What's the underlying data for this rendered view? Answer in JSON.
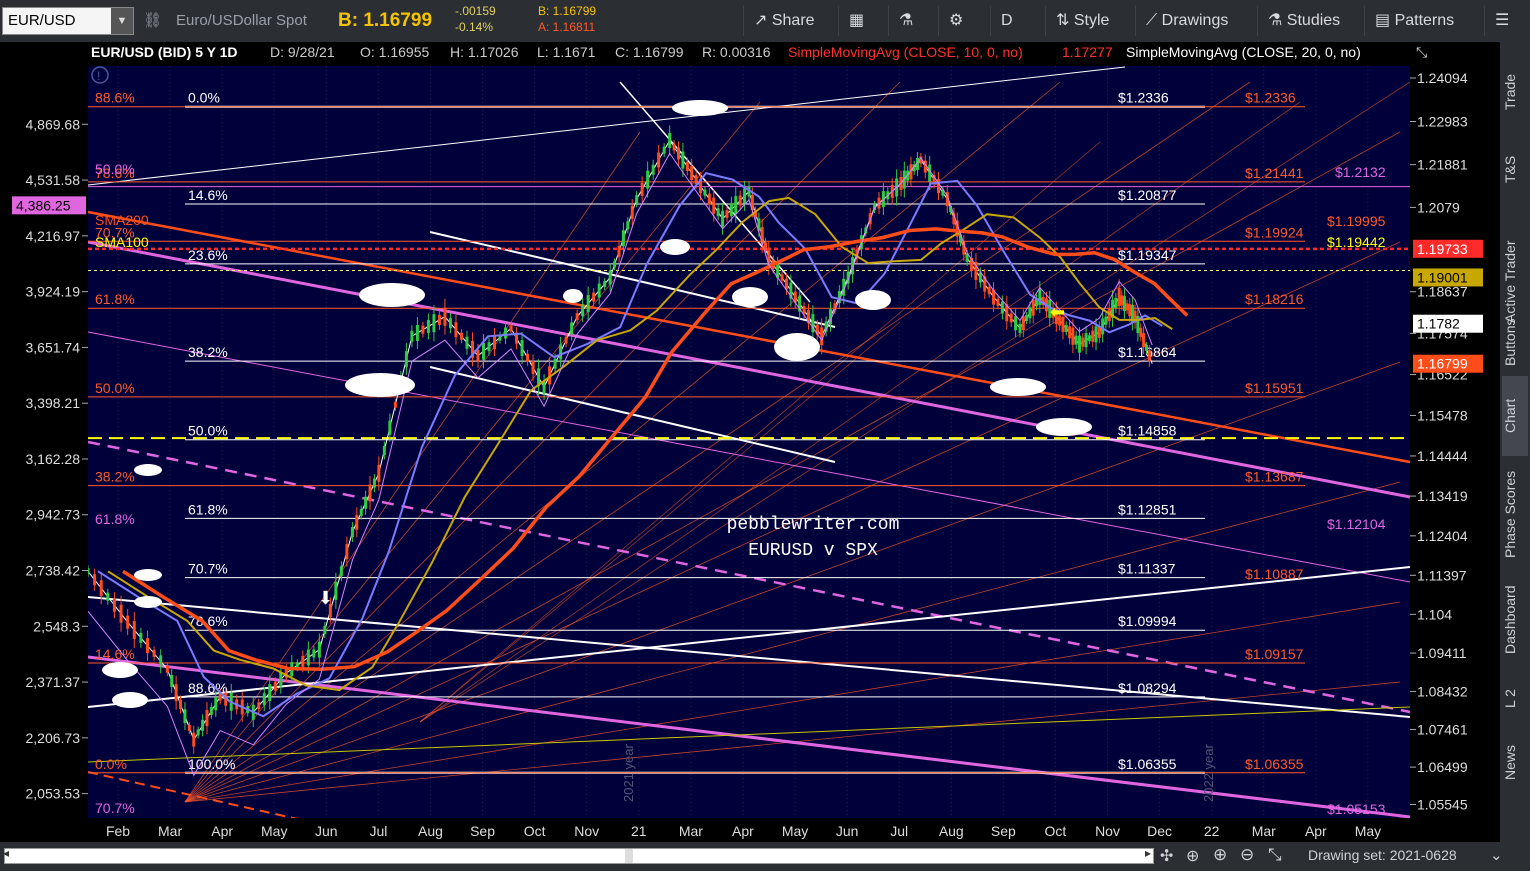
{
  "toolbar": {
    "symbol": "EUR/USD",
    "description": "Euro/USDollar Spot",
    "bid_label": "B: 1.16799",
    "change": "-.00159",
    "change_pct": "-0.14%",
    "bid_small": "B: 1.16799",
    "ask_small": "A: 1.16811",
    "share": "Share",
    "period": "D",
    "style": "Style",
    "drawings": "Drawings",
    "studies": "Studies",
    "patterns": "Patterns"
  },
  "header": {
    "title": "EUR/USD (BID) 5 Y 1D",
    "date": "D: 9/28/21",
    "open": "O: 1.16955",
    "high": "H: 1.17026",
    "low": "L: 1.1671",
    "close": "C: 1.16799",
    "range": "R: 0.00316",
    "sma10": "SimpleMovingAvg (CLOSE, 10, 0, no)",
    "sma10_val": "1.17277",
    "sma20": "SimpleMovingAvg (CLOSE, 20, 0, no)"
  },
  "sidebar": [
    "Trade",
    "T&S",
    "Active Trader",
    "Buttons",
    "Chart",
    "Phase Scores",
    "Dashboard",
    "L 2",
    "News"
  ],
  "bottombar": {
    "drawing_set": "Drawing set: 2021-0628"
  },
  "watermark": {
    "line1": "pebblewriter.com",
    "line2": "EURUSD v SPX"
  },
  "year_markers": [
    "2021 year",
    "2022 year"
  ],
  "colors": {
    "background": "#00003a",
    "candle_up": "#2ecc40",
    "candle_down": "#ff4d1a",
    "sma20": "#7b7bff",
    "sma50": "#c8a800",
    "sma200": "#ff4d1a",
    "spx": "#d884ff",
    "fib_white": "#ffffff",
    "fib_red": "#ff5a2a",
    "yellow_dash": "#ffff00",
    "magenta": "#e066e0"
  },
  "chart_data": {
    "type": "line",
    "title": "EUR/USD (BID) 5 Y 1D",
    "x": [
      "Feb",
      "Mar",
      "Apr",
      "May",
      "Jun",
      "Jul",
      "Aug",
      "Sep",
      "Oct",
      "Nov",
      "21",
      "Mar",
      "Apr",
      "May",
      "Jun",
      "Jul",
      "Aug",
      "Sep",
      "Oct",
      "Nov",
      "Dec",
      "22",
      "Mar",
      "Apr",
      "May"
    ],
    "x_ticks": [
      "Feb",
      "Mar",
      "Apr",
      "May",
      "Jun",
      "Jul",
      "Aug",
      "Sep",
      "Oct",
      "Nov",
      "21",
      "Mar",
      "Apr",
      "May",
      "Jun",
      "Jul",
      "Aug",
      "Sep",
      "Oct",
      "Nov",
      "Dec",
      "22",
      "Mar",
      "Apr",
      "May"
    ],
    "right_axis_ticks": [
      "1.24094",
      "1.22983",
      "1.21881",
      "1.2079",
      "1.18637",
      "1.17574",
      "1.16522",
      "1.15478",
      "1.14444",
      "1.13419",
      "1.12404",
      "1.11397",
      "1.104",
      "1.09411",
      "1.08432",
      "1.07461",
      "1.06499",
      "1.05545"
    ],
    "left_axis_ticks": [
      "4,869.68",
      "4,531.58",
      "4,216.97",
      "3,924.19",
      "3,651.74",
      "3,398.21",
      "3,162.28",
      "2,942.73",
      "2,738.42",
      "2,548.3",
      "2,371.37",
      "2,206.73",
      "2,053.53"
    ],
    "ylim_right": [
      1.052,
      1.244
    ],
    "ylim_left": [
      1990,
      5250
    ],
    "price_labels": [
      {
        "text": "1.1782",
        "value": 1.1782,
        "bg": "#ffffff",
        "fg": "#000000"
      },
      {
        "text": "1.16799",
        "value": 1.16799,
        "bg": "#ff4d1a",
        "fg": "#ffffff"
      },
      {
        "text": "1.19733",
        "value": 1.19733,
        "bg": "#ff2a2a",
        "fg": "#ffffff"
      },
      {
        "text": "1.19001",
        "value": 1.19001,
        "bg": "#c8a800",
        "fg": "#000000"
      },
      {
        "text": "4,386.25",
        "value": 4386.25,
        "bg": "#e066e0",
        "fg": "#000000",
        "axis": "left"
      }
    ],
    "fib_white": [
      {
        "pct": "0.0%",
        "price": "$1.2336",
        "value": 1.2336
      },
      {
        "pct": "14.6%",
        "price": "$1.20877",
        "value": 1.20877
      },
      {
        "pct": "23.6%",
        "price": "$1.19347",
        "value": 1.19347
      },
      {
        "pct": "38.2%",
        "price": "$1.16864",
        "value": 1.16864
      },
      {
        "pct": "50.0%",
        "price": "$1.14858",
        "value": 1.14858
      },
      {
        "pct": "61.8%",
        "price": "$1.12851",
        "value": 1.12851
      },
      {
        "pct": "70.7%",
        "price": "$1.11337",
        "value": 1.11337
      },
      {
        "pct": "78.6%",
        "price": "$1.09994",
        "value": 1.09994
      },
      {
        "pct": "88.6%",
        "price": "$1.08294",
        "value": 1.08294
      },
      {
        "pct": "100.0%",
        "price": "$1.06355",
        "value": 1.06355
      }
    ],
    "fib_red": [
      {
        "pct": "88.6%",
        "price": "$1.2336",
        "value": 1.2336
      },
      {
        "pct": "78.6%",
        "price": "$1.21441",
        "value": 1.21441
      },
      {
        "pct": "70.7%",
        "price": "$1.19924",
        "value": 1.19924
      },
      {
        "pct": "61.8%",
        "price": "$1.18216",
        "value": 1.18216
      },
      {
        "pct": "50.0%",
        "price": "$1.15951",
        "value": 1.15951
      },
      {
        "pct": "38.2%",
        "price": "$1.13687",
        "value": 1.13687
      },
      {
        "pct": "14.6%",
        "price": "$1.09157",
        "value": 1.09157
      },
      {
        "pct": "0.0%",
        "price": "$1.06355",
        "value": 1.06355
      }
    ],
    "other_labels": [
      {
        "text": "50.0%",
        "color": "#e066e0"
      },
      {
        "text": "61.8%",
        "color": "#e066e0"
      },
      {
        "text": "70.7%",
        "color": "#e066e0"
      },
      {
        "text": "SMA200",
        "color": "#ff4d1a"
      },
      {
        "text": "SMA100",
        "color": "#ffff00"
      },
      {
        "text": "$1.2132",
        "color": "#e066e0"
      },
      {
        "text": "$1.19995",
        "color": "#ff5a2a"
      },
      {
        "text": "$1.19442",
        "color": "#ffff00"
      },
      {
        "text": "$1.12104",
        "color": "#e066e0"
      },
      {
        "text": "$1.10887",
        "color": "#ff5a2a"
      },
      {
        "text": "$1.05153",
        "color": "#e066e0"
      }
    ],
    "price_close": [
      {
        "x": 0.0,
        "y": 1.115
      },
      {
        "x": 0.03,
        "y": 1.102
      },
      {
        "x": 0.06,
        "y": 1.09
      },
      {
        "x": 0.08,
        "y": 1.072
      },
      {
        "x": 0.1,
        "y": 1.083
      },
      {
        "x": 0.125,
        "y": 1.079
      },
      {
        "x": 0.15,
        "y": 1.089
      },
      {
        "x": 0.175,
        "y": 1.095
      },
      {
        "x": 0.2,
        "y": 1.125
      },
      {
        "x": 0.22,
        "y": 1.14
      },
      {
        "x": 0.245,
        "y": 1.175
      },
      {
        "x": 0.27,
        "y": 1.18
      },
      {
        "x": 0.295,
        "y": 1.17
      },
      {
        "x": 0.32,
        "y": 1.177
      },
      {
        "x": 0.345,
        "y": 1.162
      },
      {
        "x": 0.37,
        "y": 1.18
      },
      {
        "x": 0.395,
        "y": 1.19
      },
      {
        "x": 0.415,
        "y": 1.21
      },
      {
        "x": 0.44,
        "y": 1.225
      },
      {
        "x": 0.46,
        "y": 1.215
      },
      {
        "x": 0.48,
        "y": 1.205
      },
      {
        "x": 0.5,
        "y": 1.212
      },
      {
        "x": 0.515,
        "y": 1.195
      },
      {
        "x": 0.535,
        "y": 1.185
      },
      {
        "x": 0.555,
        "y": 1.175
      },
      {
        "x": 0.575,
        "y": 1.19
      },
      {
        "x": 0.595,
        "y": 1.208
      },
      {
        "x": 0.615,
        "y": 1.214
      },
      {
        "x": 0.63,
        "y": 1.22
      },
      {
        "x": 0.65,
        "y": 1.21
      },
      {
        "x": 0.665,
        "y": 1.195
      },
      {
        "x": 0.685,
        "y": 1.185
      },
      {
        "x": 0.705,
        "y": 1.177
      },
      {
        "x": 0.72,
        "y": 1.185
      },
      {
        "x": 0.735,
        "y": 1.179
      },
      {
        "x": 0.75,
        "y": 1.173
      },
      {
        "x": 0.765,
        "y": 1.176
      },
      {
        "x": 0.78,
        "y": 1.185
      },
      {
        "x": 0.792,
        "y": 1.18
      },
      {
        "x": 0.805,
        "y": 1.168
      }
    ],
    "series": [
      {
        "name": "SimpleMovingAvg (CLOSE, 10, 0, no)",
        "values": []
      },
      {
        "name": "SimpleMovingAvg (CLOSE, 20, 0, no)",
        "values": []
      },
      {
        "name": "SMA100",
        "values": []
      },
      {
        "name": "SMA200",
        "values": []
      }
    ]
  }
}
